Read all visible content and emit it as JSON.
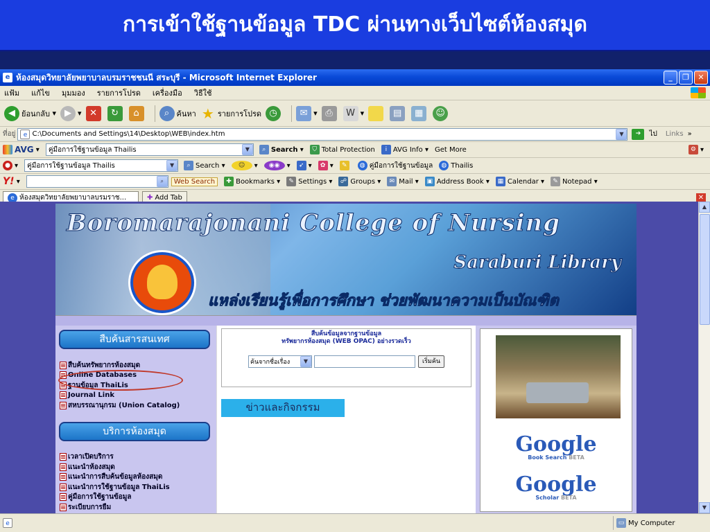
{
  "slide": {
    "title": "การเข้าใช้ฐานข้อมูล TDC ผ่านทางเว็บไซต์ห้องสมุด"
  },
  "window": {
    "title": "ห้องสมุดวิทยาลัยพยาบาลบรมราชชนนี สระบุรี - Microsoft Internet Explorer",
    "minimize": "_",
    "restore": "❐",
    "close": "✕"
  },
  "menu": [
    "แฟ้ม",
    "แก้ไข",
    "มุมมอง",
    "รายการโปรด",
    "เครื่องมือ",
    "วิธีใช้"
  ],
  "toolbar": {
    "back": "ย้อนกลับ",
    "search": "ค้นหา",
    "favorites": "รายการโปรด"
  },
  "address": {
    "label": "ที่อยู่",
    "value": "C:\\Documents and Settings\\14\\Desktop\\WEB\\index.htm",
    "go": "ไป",
    "links": "Links"
  },
  "avg": {
    "brand": "AVG",
    "query": "คู่มือการใช้ฐานข้อมูล Thailis",
    "search": "Search",
    "total": "Total Protection",
    "info": "AVG Info",
    "more": "Get More"
  },
  "bar3": {
    "query": "คู่มือการใช้ฐานข้อมูล Thailis",
    "search": "Search",
    "manual": "คู่มือการใช้ฐานข้อมูล",
    "thailis": "Thailis"
  },
  "yahoo": {
    "brand": "Y!",
    "websearch": "Web Search",
    "bookmarks": "Bookmarks",
    "settings": "Settings",
    "groups": "Groups",
    "mail": "Mail",
    "addressbook": "Address Book",
    "calendar": "Calendar",
    "notepad": "Notepad"
  },
  "tabs": {
    "active": "ห้องสมุดวิทยาลัยพยาบาลบรมราช...",
    "add": "Add Tab"
  },
  "banner": {
    "line1": "Boromarajonani College of Nursing",
    "line2": "Saraburi Library",
    "line3": "แหล่งเรียนรู้เพื่อการศึกษา ช่วยพัฒนาความเป็นบัณฑิต"
  },
  "left": {
    "search_header": "สืบค้นสารสนเทศ",
    "search_links": [
      "สืบค้นทรัพยากรห้องสมุด",
      "Online Databases",
      "ฐานข้อมูล ThaiLis",
      "Journal Link",
      "สหบรรณานุกรม (Union Catalog)"
    ],
    "service_header": "บริการห้องสมุด",
    "service_links": [
      "เวลาเปิดบริการ",
      "แนะนำห้องสมุด",
      "แนะนำการสืบค้นข้อมูลห้องสมุด",
      "แนะนำการใช้ฐานข้อมูล ThaiLis",
      "คู่มือการใช้ฐานข้อมูล",
      "ระเบียบการยืม"
    ]
  },
  "opac": {
    "line1": "สืบค้นข้อมูลจากฐานข้อมูล",
    "line2": "ทรัพยากรห้องสมุด (WEB OPAC) อย่างรวดเร็ว",
    "select": "ค้นจากชื่อเรื่อง",
    "button": "เริ่มค้น"
  },
  "news": {
    "label": "ข่าวและกิจกรรม"
  },
  "google": {
    "word": "Google",
    "book": "Book Search",
    "scholar": "Scholar",
    "beta": "BETA"
  },
  "status": {
    "zone": "My Computer"
  },
  "colors": {
    "slide_bg": "#1a3de0",
    "xp_title": "#0a4ad8",
    "pill": "#1c74c8",
    "lilac": "#c9c6ef",
    "oval": "#c0392b"
  }
}
